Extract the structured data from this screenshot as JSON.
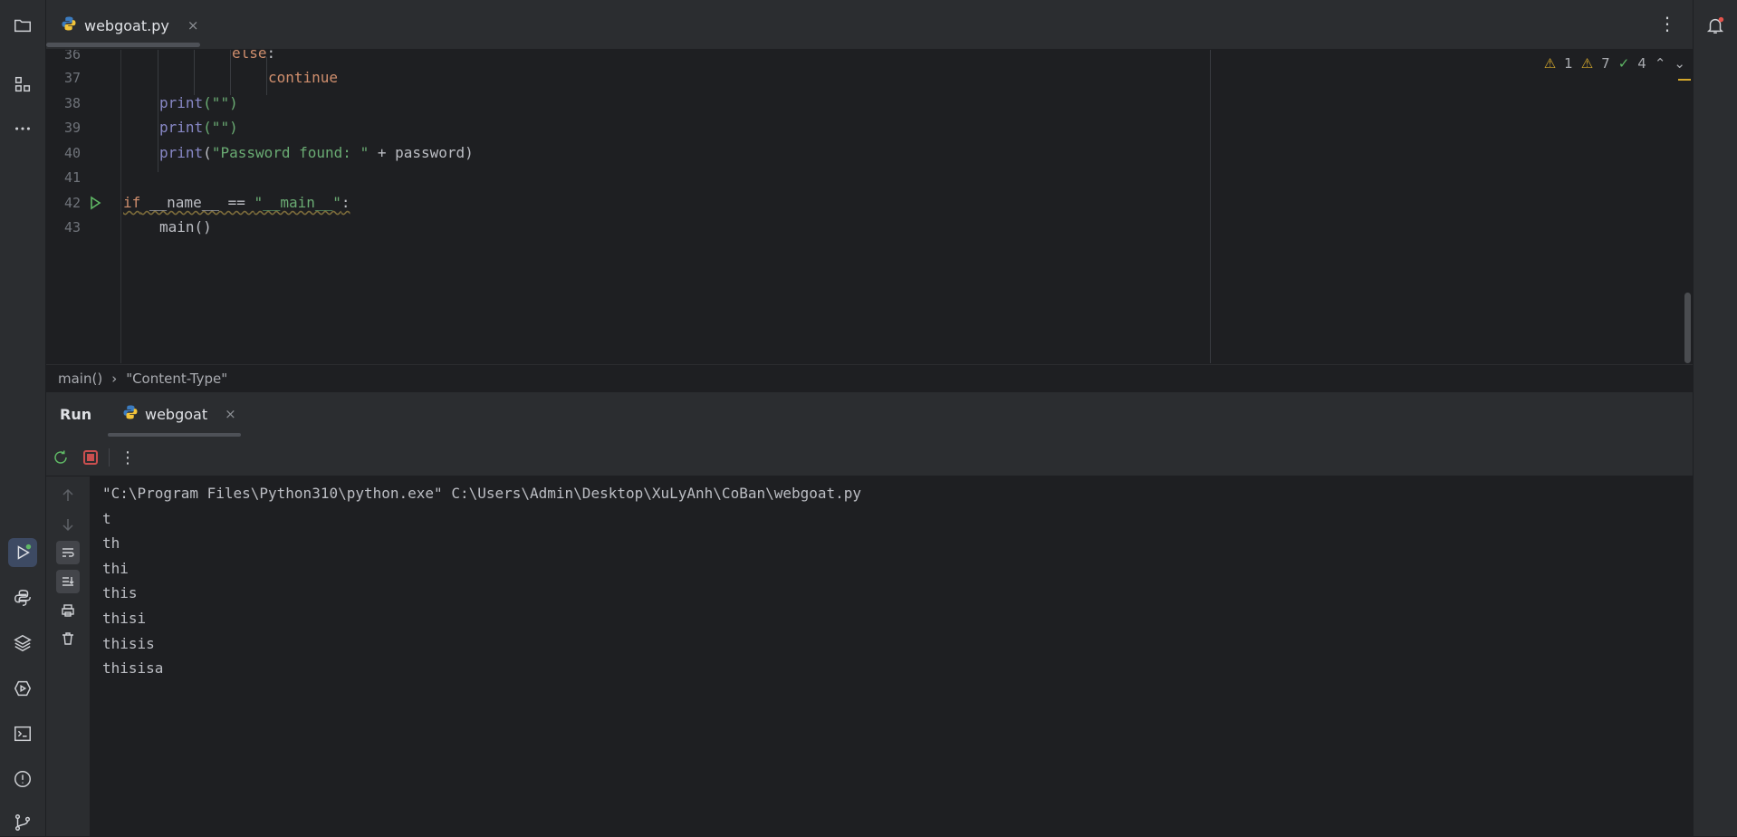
{
  "editor_tab": {
    "filename": "webgoat.py",
    "close": "×"
  },
  "inspections": {
    "errors": "1",
    "warnings": "7",
    "weak_warnings": "4"
  },
  "code": {
    "line_numbers": [
      "36",
      "37",
      "38",
      "39",
      "40",
      "41",
      "42",
      "43"
    ],
    "lines": {
      "l36_kw": "else",
      "l36_colon": ":",
      "l37_kw": "continue",
      "l38_fn": "print",
      "l38_args": "(\"\")",
      "l39_fn": "print",
      "l39_args": "(\"\")",
      "l40_fn": "print",
      "l40_open": "(",
      "l40_str": "\"Password found: \"",
      "l40_rest": " + password)",
      "l42_if": "if",
      "l42_name": " __name__ == ",
      "l42_str": "\"__main__\"",
      "l42_colon": ":",
      "l43_call": "main()"
    }
  },
  "breadcrumb": {
    "item1": "main()",
    "separator": "›",
    "item2": "\"Content-Type\""
  },
  "run_panel": {
    "title": "Run",
    "tab_label": "webgoat",
    "tab_close": "×",
    "more": "⋮"
  },
  "console_output": [
    "\"C:\\Program Files\\Python310\\python.exe\" C:\\Users\\Admin\\Desktop\\XuLyAnh\\CoBan\\webgoat.py",
    "t",
    "th",
    "thi",
    "this",
    "thisi",
    "thisis",
    "thisisa"
  ],
  "icons": {
    "project": "folder-icon",
    "structure": "structure-icon",
    "more_tools": "more-icon",
    "run": "run-icon",
    "python_console": "python-icon",
    "layers": "layers-icon",
    "services": "services-icon",
    "terminal": "terminal-icon",
    "problems": "problems-icon",
    "git": "git-icon",
    "notifications": "bell-icon"
  },
  "colors": {
    "accent": "#3d4a63",
    "stop": "#c94f4f",
    "run_green": "#5fb865",
    "warning": "#d4a72c"
  }
}
